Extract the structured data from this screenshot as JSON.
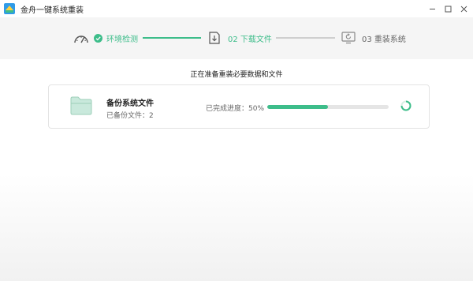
{
  "window": {
    "title": "金舟一键系统重装",
    "controls": [
      "minimize",
      "maximize",
      "close"
    ]
  },
  "steps": [
    {
      "label": "环境检测",
      "status": "done",
      "icon": "gauge-icon"
    },
    {
      "label": "02 下载文件",
      "status": "active",
      "icon": "download-icon"
    },
    {
      "label": "03 重装系统",
      "status": "todo",
      "icon": "restart-icon"
    }
  ],
  "subtitle": "正在准备重装必要数据和文件",
  "task": {
    "title": "备份系统文件",
    "subtitle": "已备份文件：2",
    "progress_label": "已完成进度：50%",
    "progress": 0.5
  },
  "colors": {
    "accent": "#3dbd8a",
    "step_bar_bg": "#f5f5f5",
    "track": "#e5e5e5"
  }
}
